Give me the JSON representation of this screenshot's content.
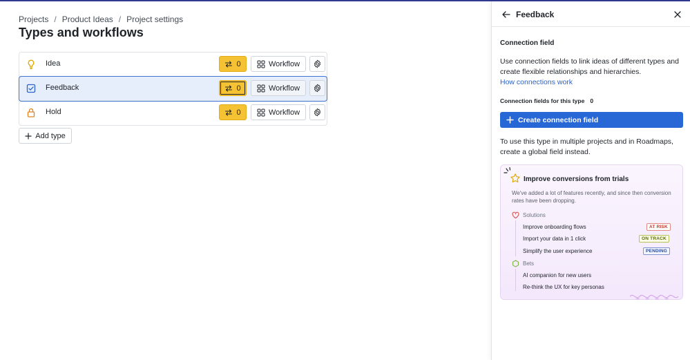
{
  "breadcrumb": [
    "Projects",
    "Product Ideas",
    "Project settings"
  ],
  "page_title": "Types and workflows",
  "types": [
    {
      "name": "Idea",
      "icon": "lightbulb-icon",
      "connections": "0",
      "workflow_label": "Workflow",
      "selected": false
    },
    {
      "name": "Feedback",
      "icon": "checkbox-icon",
      "connections": "0",
      "workflow_label": "Workflow",
      "selected": true
    },
    {
      "name": "Hold",
      "icon": "lock-icon",
      "connections": "0",
      "workflow_label": "Workflow",
      "selected": false
    }
  ],
  "add_type_label": "Add type",
  "panel": {
    "title": "Feedback",
    "section_title": "Connection field",
    "description": "Use connection fields to link ideas of different types and create flexible relationships and hierarchies.",
    "link_text": "How connections work",
    "count_label": "Connection fields for this type",
    "count_value": "0",
    "create_button": "Create connection field",
    "global_note": "To use this type in multiple projects and in Roadmaps, create a global field instead.",
    "promo": {
      "title": "Improve conversions from trials",
      "description": "We've added a lot of features recently, and since then conversion rates have been dropping.",
      "groups": [
        {
          "label": "Solutions",
          "icon": "heart-icon",
          "items": [
            {
              "text": "Improve onboarding flows",
              "badge": "AT RISK",
              "badge_kind": "risk"
            },
            {
              "text": "Import your data in 1 click",
              "badge": "ON TRACK",
              "badge_kind": "track"
            },
            {
              "text": "Simplify the user experience",
              "badge": "PENDING",
              "badge_kind": "pend"
            }
          ]
        },
        {
          "label": "Bets",
          "icon": "hexagon-icon",
          "items": [
            {
              "text": "AI companion for new users"
            },
            {
              "text": "Re-think the UX for key personas"
            }
          ]
        }
      ]
    }
  },
  "colors": {
    "accent": "#2767d6",
    "connection_button": "#f4c233",
    "selected_row": "#e6eefc",
    "idea_icon": "#e0a800",
    "hold_icon": "#e0821f",
    "feedback_icon": "#2a63c9"
  }
}
